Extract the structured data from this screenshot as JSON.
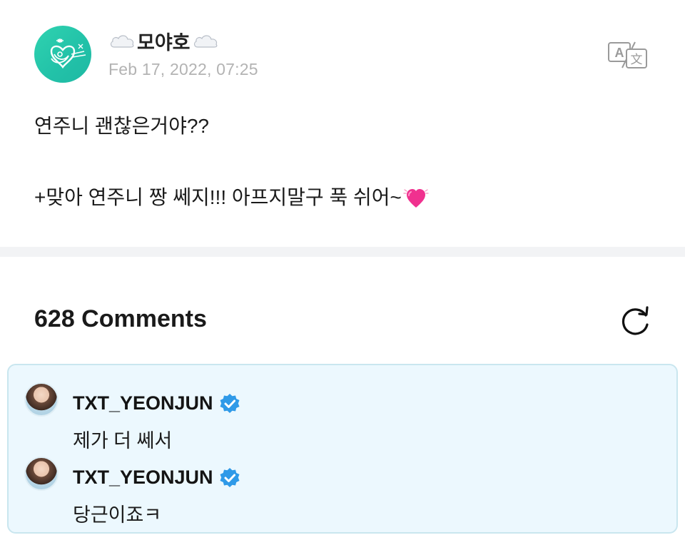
{
  "post": {
    "author": "모야호",
    "date": "Feb 17, 2022, 07:25",
    "lines": [
      "연주니 괜찮은거야??",
      "",
      "+맞아 연주니 짱 쎄지!!! 아프지말구 푹 쉬어~"
    ],
    "emoji": "heart-emoji"
  },
  "comments_section": {
    "title": "628 Comments",
    "refresh_icon": "refresh-icon"
  },
  "highlighted_comments": [
    {
      "author": "TXT_YEONJUN",
      "verified": true,
      "text": "제가 더 쎄서"
    },
    {
      "author": "TXT_YEONJUN",
      "verified": true,
      "text": "당근이죠ㅋ"
    }
  ],
  "colors": {
    "accent": "#22c1a8",
    "verified": "#2f9ae8",
    "highlight_bg": "#ecf8fe",
    "highlight_border": "#c9e6ef",
    "date": "#b3b3b3"
  }
}
